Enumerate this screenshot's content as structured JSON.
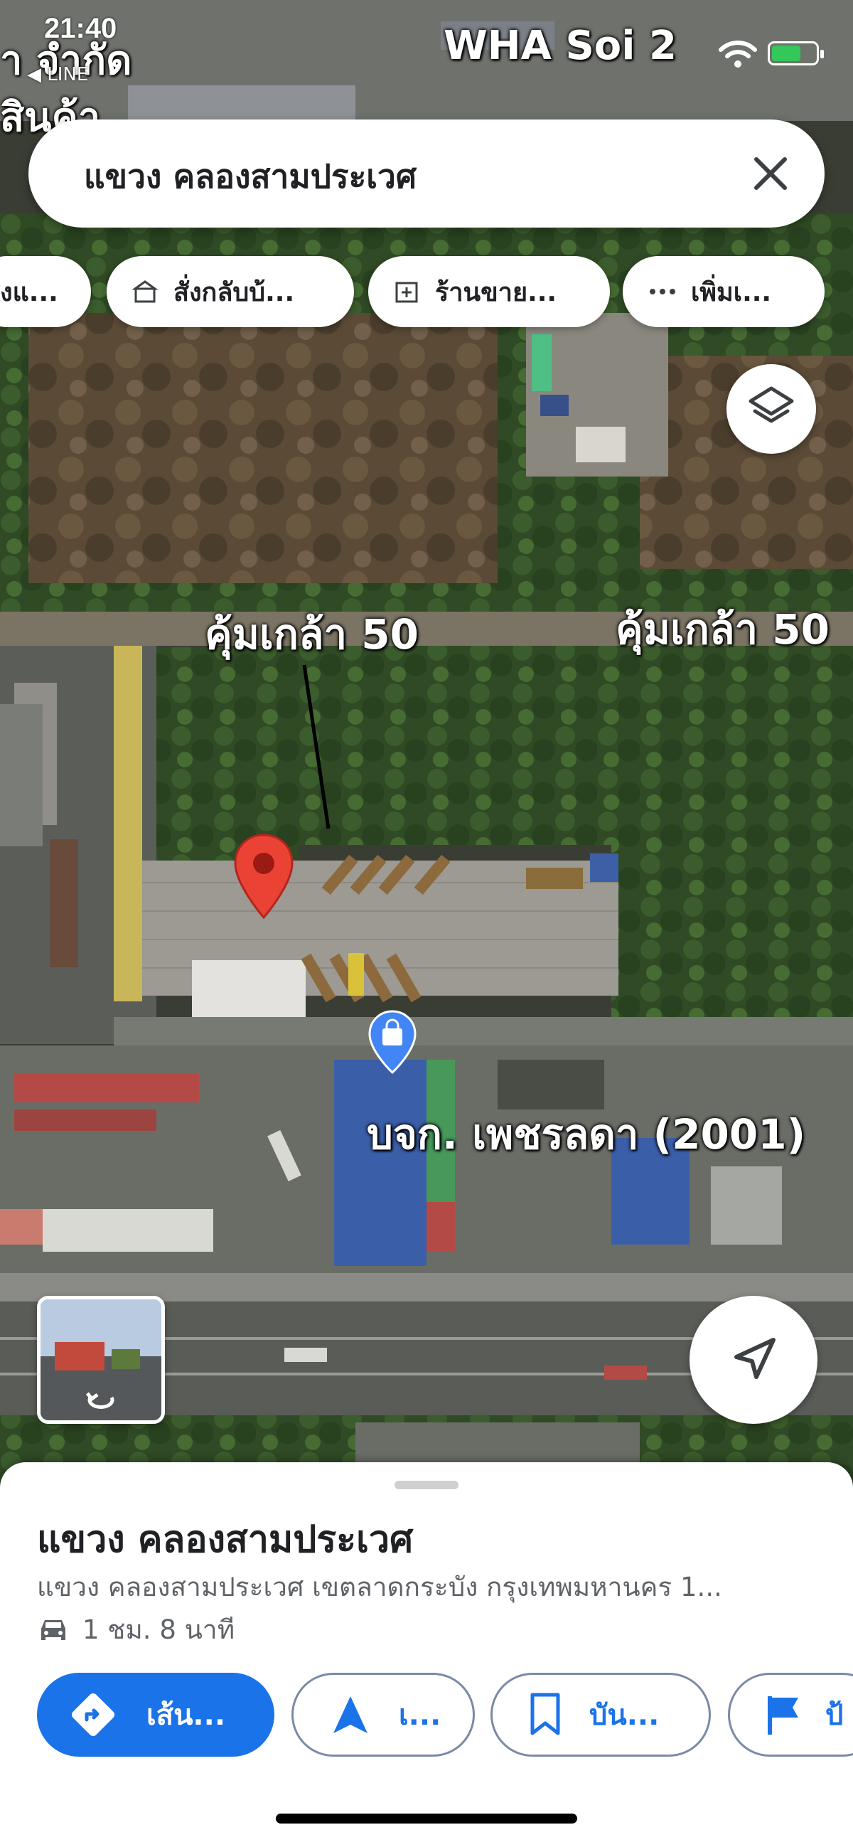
{
  "status_bar": {
    "time": "21:40",
    "back_app": "◀ LINE",
    "location_text": "WHA Soi 2"
  },
  "background_text": {
    "line1": "า จำกัด",
    "line2": "สินค้า"
  },
  "search": {
    "query": "แขวง คลองสามประเวศ",
    "clear_icon": "close-icon"
  },
  "chips": [
    {
      "label": "งแ...",
      "icon": ""
    },
    {
      "label": "สั่งกลับบ้...",
      "icon": "takeout-box-icon"
    },
    {
      "label": "ร้านขาย...",
      "icon": "pharmacy-icon"
    },
    {
      "label": "เพิ่มเ...",
      "icon": "more-dots-icon"
    }
  ],
  "map": {
    "road_label_1": "คุ้มเกล้า 50",
    "road_label_2": "คุ้มเกล้า 50",
    "business_label": "บจก. เพชรลดา (2001)",
    "pin_color": "#ea4335",
    "business_pin_color": "#4285f4"
  },
  "place": {
    "title": "แขวง คลองสามประเวศ",
    "address": "แขวง คลองสามประเวศ เขตลาดกระบัง กรุงเทพมหานคร 1...",
    "travel_time": "1 ชม. 8 นาที",
    "travel_mode_icon": "car-icon"
  },
  "actions": [
    {
      "label": "เส้น...",
      "icon": "directions-icon"
    },
    {
      "label": "เ...",
      "icon": "navigation-arrow-icon"
    },
    {
      "label": "บัน...",
      "icon": "bookmark-icon"
    },
    {
      "label": "ป้",
      "icon": "flag-icon"
    }
  ],
  "colors": {
    "accent": "#1a73e8",
    "pin_red": "#ea4335"
  }
}
